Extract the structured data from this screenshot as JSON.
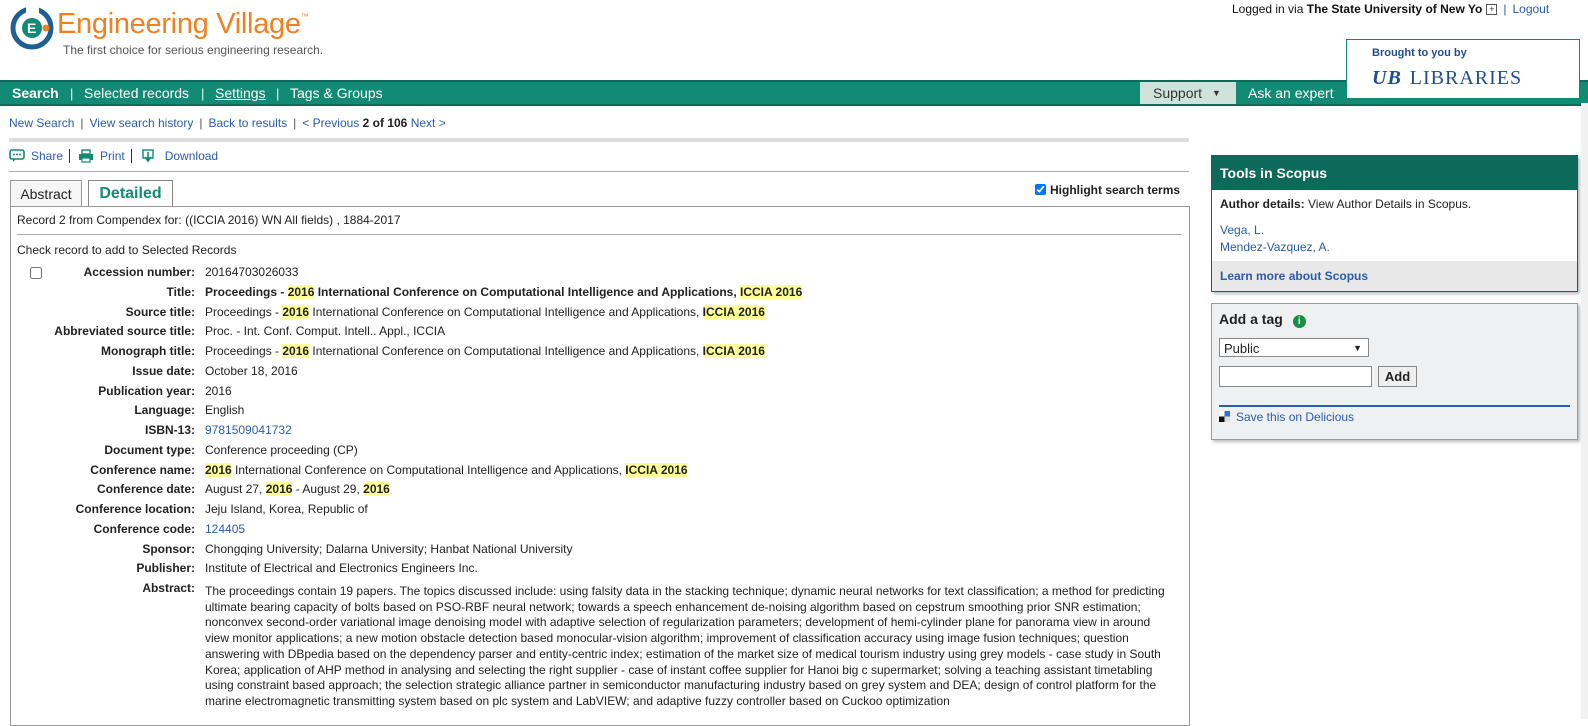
{
  "header": {
    "logo_name": "Engineering Village",
    "logo_tm": "™",
    "tagline": "The first choice for serious engineering research.",
    "login_prefix": "Logged in via ",
    "login_institution": "The State University of New Yo",
    "logout": "Logout",
    "brought_by": "Brought to you by",
    "ub_mark": "UB",
    "libraries": "LIBRARIES"
  },
  "nav": {
    "search": "Search",
    "selected_records": "Selected records",
    "settings": "Settings",
    "tags_groups": "Tags & Groups",
    "support": "Support",
    "ask_expert": "Ask an expert"
  },
  "subnav": {
    "new_search": "New Search",
    "view_history": "View search history",
    "back": "Back to results",
    "previous": "< Previous",
    "position": "2 of 106",
    "next": "Next >"
  },
  "actions": {
    "share": "Share",
    "print": "Print",
    "download": "Download"
  },
  "tabs": {
    "abstract": "Abstract",
    "detailed": "Detailed"
  },
  "highlight_label": "Highlight search terms",
  "record": {
    "from": "Record 2 from Compendex for: ((ICCIA 2016) WN All fields) , 1884-2017",
    "check_label": "Check record to add to Selected Records",
    "fields": [
      {
        "label": "Accession number:",
        "value": "20164703026033"
      },
      {
        "label": "Title:",
        "v1": "Proceedings - ",
        "h1": "2016",
        "v2": " International Conference on Computational Intelligence and Applications, ",
        "h2": "ICCIA 2016"
      },
      {
        "label": "Source title:",
        "v1": "Proceedings - ",
        "h1": "2016",
        "v2": " International Conference on Computational Intelligence and Applications, ",
        "h2": "ICCIA 2016"
      },
      {
        "label": "Abbreviated source title:",
        "value": "Proc. - Int. Conf. Comput. Intell.. Appl., ICCIA"
      },
      {
        "label": "Monograph title:",
        "v1": "Proceedings - ",
        "h1": "2016",
        "v2": " International Conference on Computational Intelligence and Applications, ",
        "h2": "ICCIA 2016"
      },
      {
        "label": "Issue date:",
        "value": "October 18, 2016"
      },
      {
        "label": "Publication year:",
        "value": "2016"
      },
      {
        "label": "Language:",
        "value": "English"
      },
      {
        "label": "ISBN-13:",
        "value": "9781509041732"
      },
      {
        "label": "Document type:",
        "value": "Conference proceeding (CP)"
      },
      {
        "label": "Conference name:",
        "h1": "2016",
        "v2": " International Conference on Computational Intelligence and Applications, ",
        "h2": "ICCIA 2016"
      },
      {
        "label": "Conference date:",
        "v1": "August 27, ",
        "h1": "2016",
        "v2": " - August 29, ",
        "h2": "2016"
      },
      {
        "label": "Conference location:",
        "value": "Jeju Island, Korea, Republic of"
      },
      {
        "label": "Conference code:",
        "value": "124405"
      },
      {
        "label": "Sponsor:",
        "value": "Chongqing University; Dalarna University; Hanbat National University"
      },
      {
        "label": "Publisher:",
        "value": "Institute of Electrical and Electronics Engineers Inc."
      },
      {
        "label": "Abstract:"
      }
    ],
    "abstract_text": "The proceedings contain 19 papers. The topics discussed include: using falsity data in the stacking technique; dynamic neural networks for text classification; a method for predicting ultimate bearing capacity of bolts based on PSO-RBF neural network; towards a speech enhancement de-noising algorithm based on cepstrum smoothing prior SNR estimation; nonconvex second-order variational image denoising model with adaptive selection of regularization parameters; development of hemi-cylinder plane for panorama view in around view monitor applications; a new motion obstacle detection based monocular-vision algorithm; improvement of classification accuracy using image fusion techniques; question answering with DBpedia based on the dependency parser and entity-centric index; estimation of the market size of medical tourism industry using grey models - case study in South Korea; application of AHP method in analysing and selecting the right supplier - case of instant coffee supplier for Hanoi big c supermarket; solving a teaching assistant timetabling using constraint based approach; the selection strategic alliance partner in semiconductor manufacturing industry based on grey system and DEA; design of control platform for the marine electromagnetic transmitting system based on plc system and LabVIEW; and adaptive fuzzy controller based on Cuckoo optimization"
  },
  "sidebar": {
    "scopus_title": "Tools in Scopus",
    "author_details_label": "Author details:",
    "author_details_text": " View Author Details in Scopus.",
    "authors": [
      "Vega, L.",
      "Mendez-Vazquez, A."
    ],
    "learn_more": "Learn more about Scopus",
    "tag_title": "Add a tag",
    "tag_visibility": "Public",
    "add_button": "Add",
    "delicious": "Save this on Delicious"
  },
  "colors": {
    "brand_green": "#128b75",
    "header_orange": "#f0801f",
    "link_blue": "#2a5ca8",
    "highlight": "#ffff99"
  }
}
